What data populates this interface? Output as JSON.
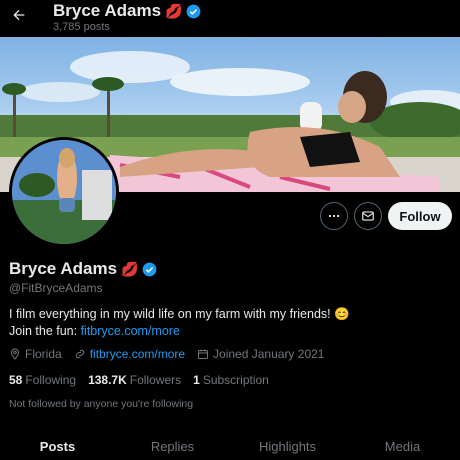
{
  "header": {
    "name": "Bryce Adams",
    "name_emoji": "💋",
    "posts_count": "3,785 posts"
  },
  "colors": {
    "accent": "#1d9bf0",
    "background": "#000000",
    "text_primary": "#e7e9ea",
    "text_secondary": "#71767b"
  },
  "actions": {
    "more_icon": "ellipsis-icon",
    "message_icon": "envelope-icon",
    "follow_label": "Follow"
  },
  "profile": {
    "display_name": "Bryce Adams",
    "name_emoji": "💋",
    "handle": "@FitBryceAdams",
    "bio_line1": "I film everything in my wild life on my farm with my friends! 😊",
    "bio_line2_prefix": "Join the fun: ",
    "bio_link": "fitbryce.com/more",
    "location": "Florida",
    "website": "fitbryce.com/more",
    "joined": "Joined January 2021",
    "following_count": "58",
    "following_label": "Following",
    "followers_count": "138.7K",
    "followers_label": "Followers",
    "subscriptions_count": "1",
    "subscriptions_label": "Subscription",
    "not_followed_text": "Not followed by anyone you're following"
  },
  "tabs": [
    {
      "label": "Posts",
      "active": true
    },
    {
      "label": "Replies",
      "active": false
    },
    {
      "label": "Highlights",
      "active": false
    },
    {
      "label": "Media",
      "active": false
    }
  ]
}
